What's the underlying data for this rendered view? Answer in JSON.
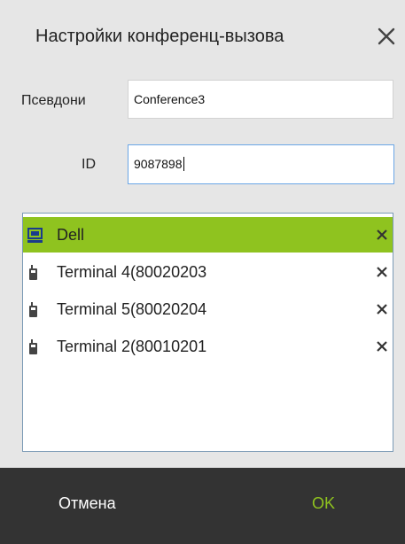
{
  "dialog": {
    "title": "Настройки конференц-вызова",
    "close_icon": "close-icon"
  },
  "form": {
    "alias_label": "Псевдони",
    "alias_value": "Conference3",
    "id_label": "ID",
    "id_value": "9087898"
  },
  "participants": [
    {
      "label": "Dell",
      "icon": "computer-icon",
      "selected": true
    },
    {
      "label": "Terminal 4(80020203",
      "icon": "phone-terminal-icon",
      "selected": false
    },
    {
      "label": "Terminal 5(80020204",
      "icon": "phone-terminal-icon",
      "selected": false
    },
    {
      "label": "Terminal 2(80010201",
      "icon": "phone-terminal-icon",
      "selected": false
    }
  ],
  "footer": {
    "cancel_label": "Отмена",
    "ok_label": "OK"
  },
  "colors": {
    "accent": "#8fc31f",
    "footer_bg": "#333333",
    "dialog_bg": "#e6e6e6"
  }
}
